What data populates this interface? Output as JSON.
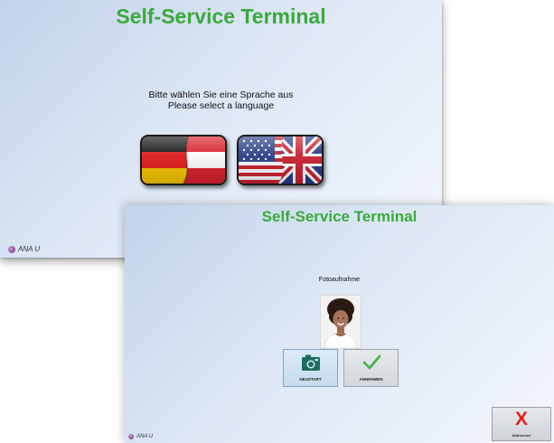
{
  "language_screen": {
    "title": "Self-Service Terminal",
    "prompt_de": "Bitte wählen Sie eine Sprache aus",
    "prompt_en": "Please select a language",
    "options": [
      {
        "icon": "flag-germany-austria-icon"
      },
      {
        "icon": "flag-usa-uk-icon"
      }
    ],
    "logo_text": "ANA U"
  },
  "photo_screen": {
    "title": "Self-Service Terminal",
    "heading": "Fotoaufnahme",
    "restart_label": "NEUSTART",
    "accept_label": "ANNEHMEN",
    "cancel_label": "Abbrechen",
    "cancel_glyph": "X",
    "logo_text": "ANA U"
  },
  "colors": {
    "title_green": "#3aaa3a",
    "accept_green": "#3bb34a",
    "cancel_red": "#e0231b",
    "camera_teal": "#1e6b62"
  }
}
